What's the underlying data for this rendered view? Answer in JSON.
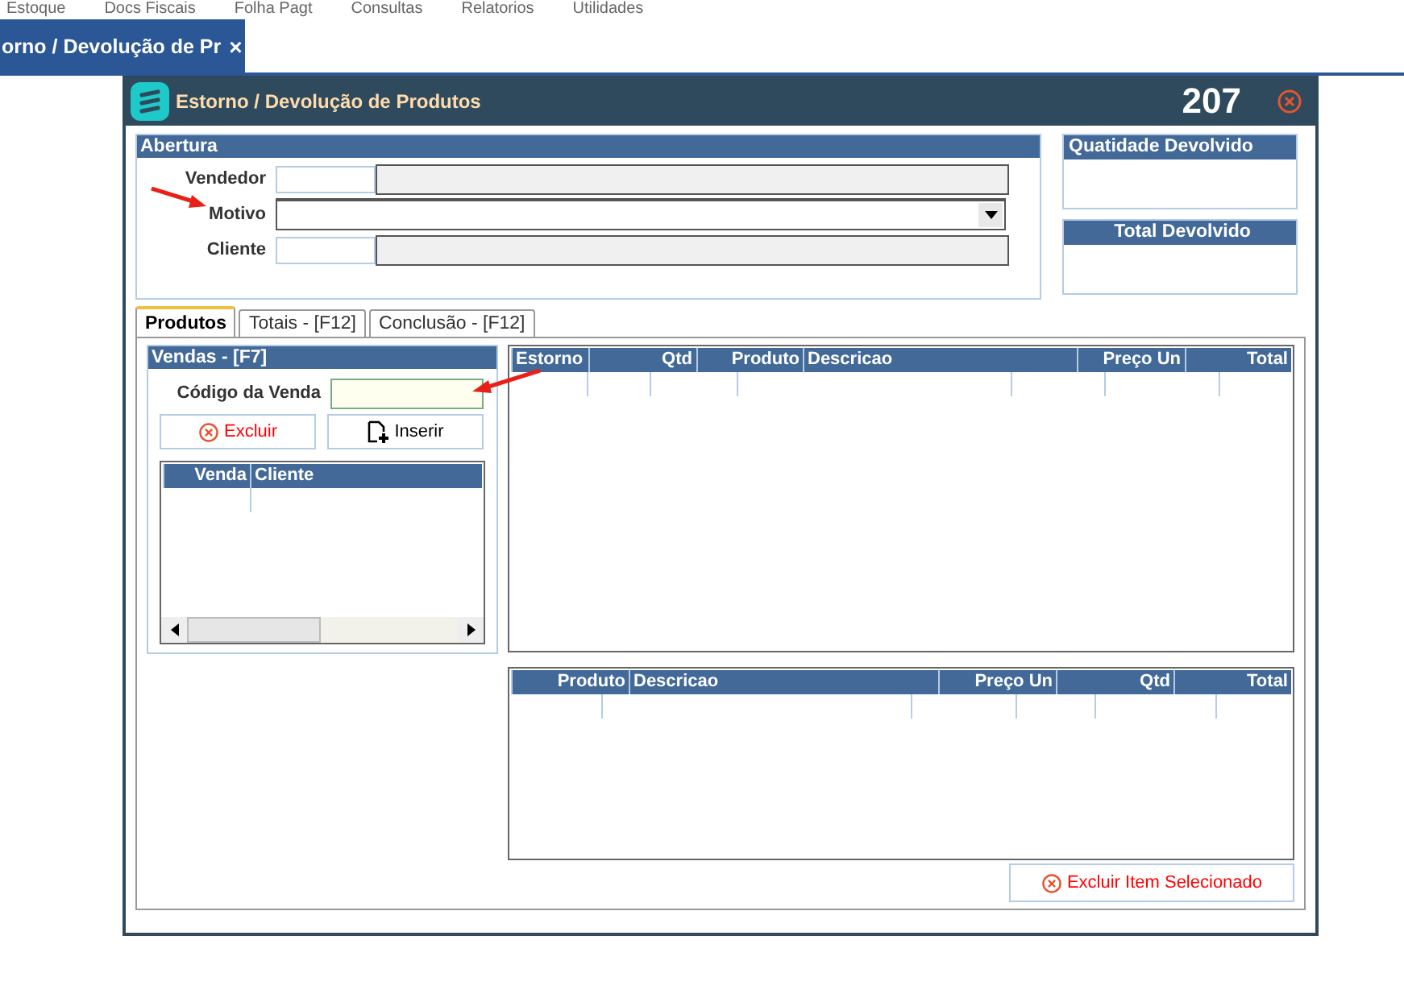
{
  "menu": [
    "Estoque",
    "Docs Fiscais",
    "Folha Pagt",
    "Consultas",
    "Relatorios",
    "Utilidades"
  ],
  "page_tab": {
    "label": "orno / Devolução de Pr",
    "close": "×"
  },
  "dialog": {
    "title": "Estorno / Devolução de Produtos",
    "number": "207"
  },
  "abertura": {
    "title": "Abertura",
    "fields": [
      {
        "label": "Vendedor",
        "kind": "lookup"
      },
      {
        "label": "Motivo",
        "kind": "dropdown"
      },
      {
        "label": "Cliente",
        "kind": "lookup"
      }
    ]
  },
  "side_panels": [
    {
      "title": "Quatidade Devolvido"
    },
    {
      "title": "Total Devolvido"
    }
  ],
  "tabs": [
    {
      "label": "Produtos",
      "selected": true
    },
    {
      "label": "Totais - [F12]",
      "selected": false
    },
    {
      "label": "Conclusão - [F12]",
      "selected": false
    }
  ],
  "vendas": {
    "title": "Vendas - [F7]",
    "code_label": "Código da Venda",
    "buttons": [
      {
        "label": "Excluir",
        "kind": "delete"
      },
      {
        "label": "Inserir",
        "kind": "insert"
      }
    ],
    "columns": [
      "Venda",
      "Cliente"
    ]
  },
  "estorno_grid": {
    "columns": [
      "Estorno",
      "Qtd",
      "Produto",
      "Descricao",
      "Preço Un",
      "Total"
    ]
  },
  "itens_grid": {
    "columns": [
      "Produto",
      "Descricao",
      "Preço Un",
      "Qtd",
      "Total"
    ]
  },
  "delete_selected_button": {
    "label": "Excluir Item Selecionado"
  }
}
